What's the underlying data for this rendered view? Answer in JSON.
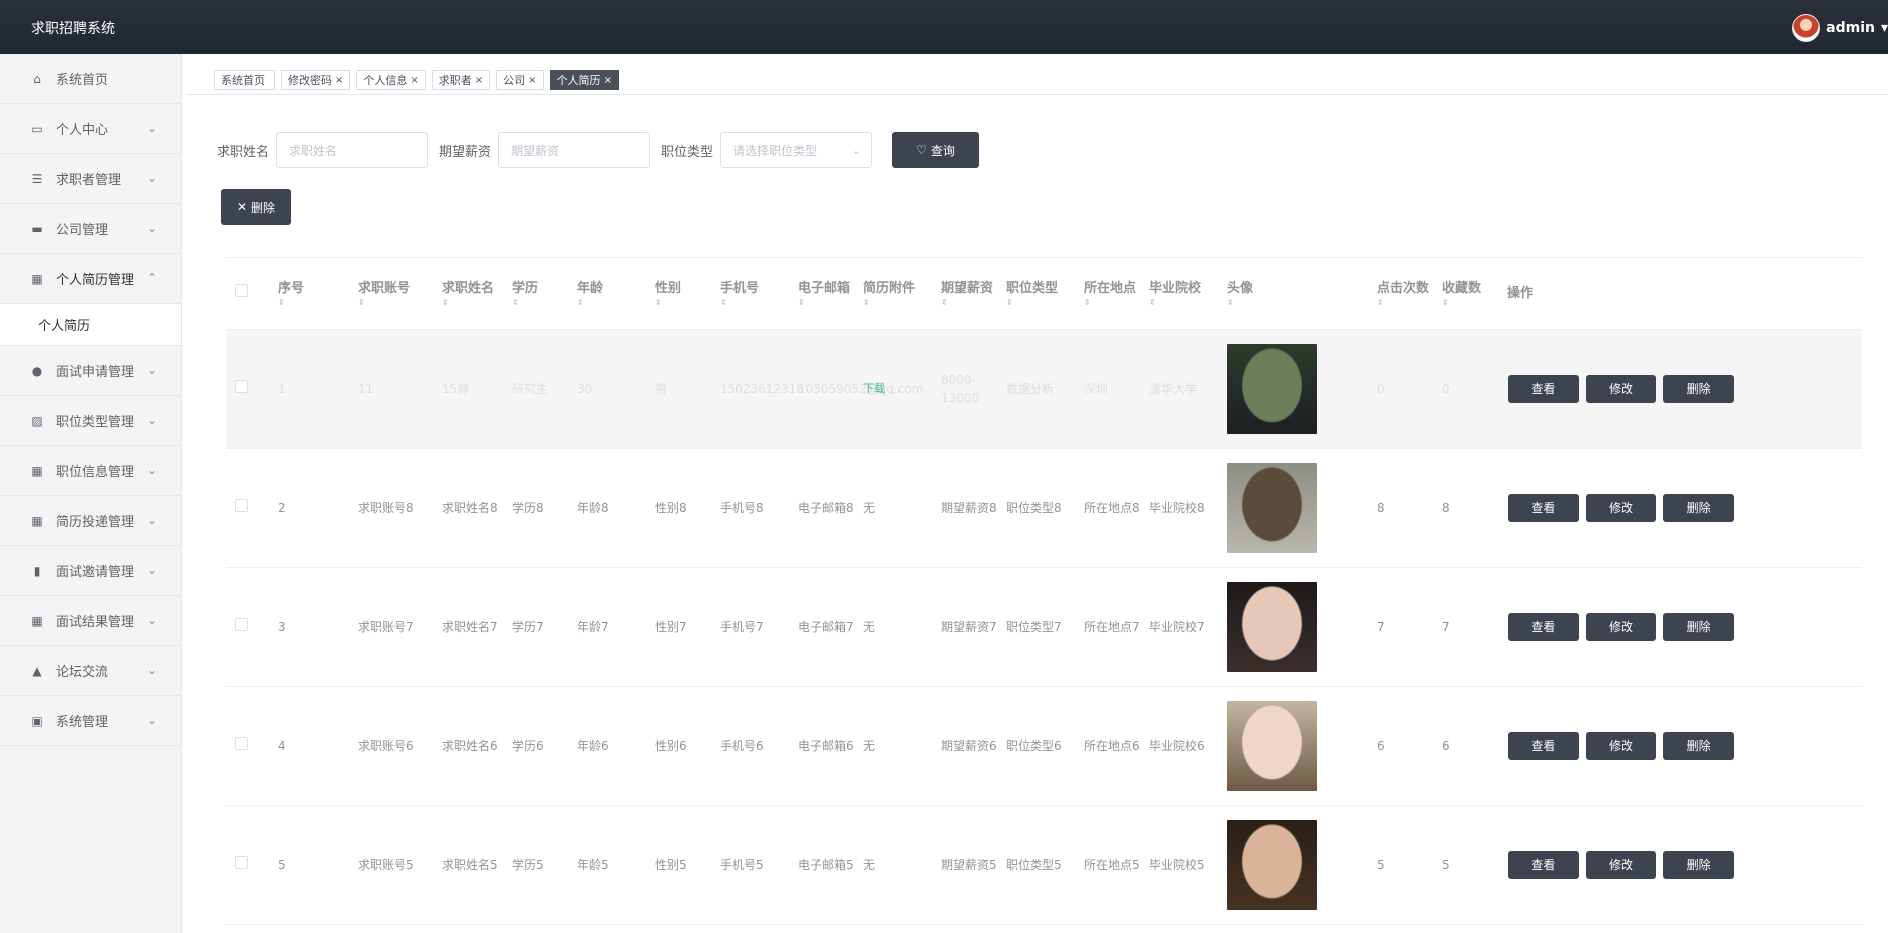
{
  "app_title": "求职招聘系统",
  "user": {
    "name": "admin",
    "caret": "▾"
  },
  "sidebar": {
    "items": [
      {
        "label": "系统首页",
        "icon": "⌂",
        "arrow": ""
      },
      {
        "label": "个人中心",
        "icon": "▭",
        "arrow": "⌄"
      },
      {
        "label": "求职者管理",
        "icon": "☰",
        "arrow": "⌄"
      },
      {
        "label": "公司管理",
        "icon": "▬",
        "arrow": "⌄"
      },
      {
        "label": "个人简历管理",
        "icon": "▦",
        "arrow": "⌃"
      },
      {
        "label": "面试申请管理",
        "icon": "●",
        "arrow": "⌄"
      },
      {
        "label": "职位类型管理",
        "icon": "▨",
        "arrow": "⌄"
      },
      {
        "label": "职位信息管理",
        "icon": "▦",
        "arrow": "⌄"
      },
      {
        "label": "简历投递管理",
        "icon": "▦",
        "arrow": "⌄"
      },
      {
        "label": "面试邀请管理",
        "icon": "▮",
        "arrow": "⌄"
      },
      {
        "label": "面试结果管理",
        "icon": "▦",
        "arrow": "⌄"
      },
      {
        "label": "论坛交流",
        "icon": "▲",
        "arrow": "⌄"
      },
      {
        "label": "系统管理",
        "icon": "▣",
        "arrow": "⌄"
      }
    ],
    "submenu": "个人简历"
  },
  "tabs": [
    {
      "label": "系统首页",
      "close": ""
    },
    {
      "label": "修改密码",
      "close": "×"
    },
    {
      "label": "个人信息",
      "close": "×"
    },
    {
      "label": "求职者",
      "close": "×"
    },
    {
      "label": "公司",
      "close": "×"
    },
    {
      "label": "个人简历",
      "close": "×"
    }
  ],
  "filters": {
    "name_label": "求职姓名",
    "name_placeholder": "求职姓名",
    "salary_label": "期望薪资",
    "salary_placeholder": "期望薪资",
    "type_label": "职位类型",
    "type_placeholder": "请选择职位类型",
    "search_btn": "查询",
    "search_icon": "♡"
  },
  "delete_btn": {
    "label": "删除",
    "icon": "✕"
  },
  "table": {
    "headers": [
      "序号",
      "求职账号",
      "求职姓名",
      "学历",
      "年龄",
      "性别",
      "手机号",
      "电子邮箱",
      "简历附件",
      "期望薪资",
      "职位类型",
      "所在地点",
      "毕业院校",
      "头像",
      "点击次数",
      "收藏数",
      "操作"
    ],
    "sort_mark": "⇕",
    "rows": [
      {
        "idx": "1",
        "account": "11",
        "name": "15静",
        "edu": "研究生",
        "age": "30",
        "sex": "男",
        "phone": "15023612316",
        "email": "105059052@qq.com",
        "attach": "下载",
        "salary": "8000-13000",
        "type": "数据分析",
        "place": "深圳",
        "school": "清华大学",
        "clicks": "0",
        "fav": "0",
        "photo": [
          "#2e3a2c",
          "#6b7d5a",
          "#1d1f22"
        ]
      },
      {
        "idx": "2",
        "account": "求职账号8",
        "name": "求职姓名8",
        "edu": "学历8",
        "age": "年龄8",
        "sex": "性别8",
        "phone": "手机号8",
        "email": "电子邮箱8",
        "attach": "无",
        "salary": "期望薪资8",
        "type": "职位类型8",
        "place": "所在地点8",
        "school": "毕业院校8",
        "clicks": "8",
        "fav": "8",
        "photo": [
          "#8c8f87",
          "#5c4a3a",
          "#b9b6ab"
        ]
      },
      {
        "idx": "3",
        "account": "求职账号7",
        "name": "求职姓名7",
        "edu": "学历7",
        "age": "年龄7",
        "sex": "性别7",
        "phone": "手机号7",
        "email": "电子邮箱7",
        "attach": "无",
        "salary": "期望薪资7",
        "type": "职位类型7",
        "place": "所在地点7",
        "school": "毕业院校7",
        "clicks": "7",
        "fav": "7",
        "photo": [
          "#1e1a19",
          "#e5c8b8",
          "#3b2f2c"
        ]
      },
      {
        "idx": "4",
        "account": "求职账号6",
        "name": "求职姓名6",
        "edu": "学历6",
        "age": "年龄6",
        "sex": "性别6",
        "phone": "手机号6",
        "email": "电子邮箱6",
        "attach": "无",
        "salary": "期望薪资6",
        "type": "职位类型6",
        "place": "所在地点6",
        "school": "毕业院校6",
        "clicks": "6",
        "fav": "6",
        "photo": [
          "#c2b5a0",
          "#f0d6c6",
          "#6e5a45"
        ]
      },
      {
        "idx": "5",
        "account": "求职账号5",
        "name": "求职姓名5",
        "edu": "学历5",
        "age": "年龄5",
        "sex": "性别5",
        "phone": "手机号5",
        "email": "电子邮箱5",
        "attach": "无",
        "salary": "期望薪资5",
        "type": "职位类型5",
        "place": "所在地点5",
        "school": "毕业院校5",
        "clicks": "5",
        "fav": "5",
        "photo": [
          "#2a1e16",
          "#d9b49a",
          "#473323"
        ]
      }
    ],
    "actions": {
      "view": "查看",
      "edit": "修改",
      "del": "删除"
    }
  },
  "colors": {
    "topbar": "#222831",
    "button": "#3d4450",
    "link": "#3ab88e"
  }
}
